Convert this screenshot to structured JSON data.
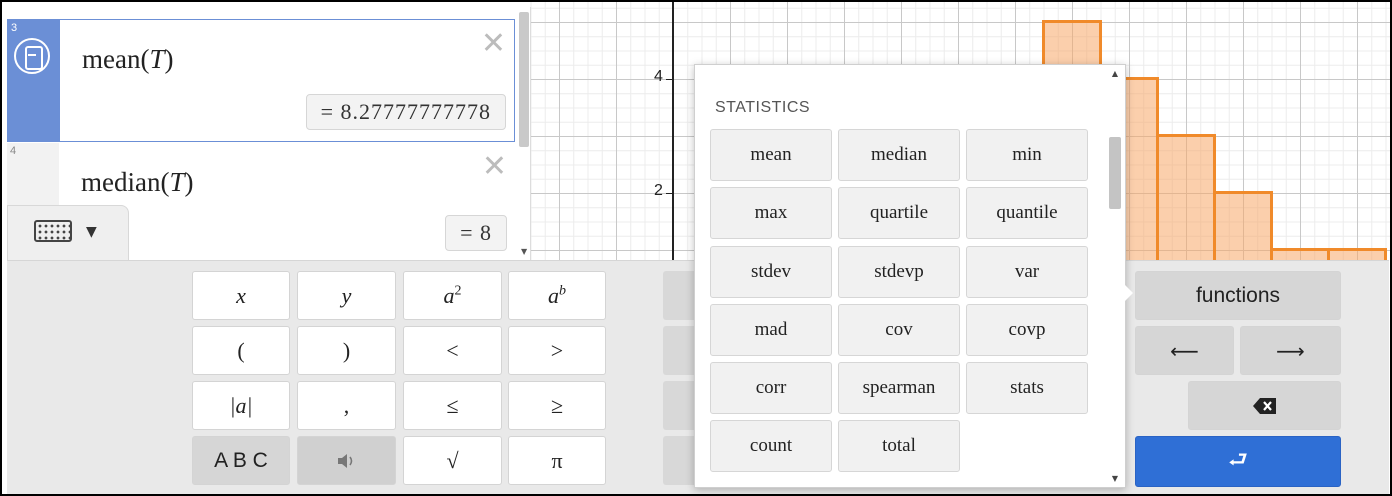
{
  "graph": {
    "y_ticks": [
      "4",
      "2"
    ]
  },
  "expressions": [
    {
      "index": "3",
      "func": "mean",
      "arg": "T",
      "result": "= 8.27777777778"
    },
    {
      "index": "4",
      "func": "median",
      "arg": "T",
      "result": "= 8"
    }
  ],
  "keypad": {
    "x": "x",
    "y": "y",
    "a": "a",
    "sq_exp": "2",
    "b_exp": "b",
    "lparen": "(",
    "rparen": ")",
    "lt": "<",
    "gt": ">",
    "abs": "|a|",
    "comma": ",",
    "le": "≤",
    "ge": "≥",
    "abc": "A B C",
    "sqrt": "√",
    "pi": "π",
    "functions": "functions",
    "left": "⟵",
    "right": "⟶",
    "enter": "⮐"
  },
  "popup": {
    "title": "STATISTICS",
    "functions": [
      "mean",
      "median",
      "min",
      "max",
      "quartile",
      "quantile",
      "stdev",
      "stdevp",
      "var",
      "mad",
      "cov",
      "covp",
      "corr",
      "spearman",
      "stats",
      "count",
      "total"
    ]
  },
  "colors": {
    "accent": "#2f6fd6",
    "selected": "#6b8fd6",
    "histogram_fill": "#f8a868",
    "histogram_stroke": "#f08a2a"
  },
  "icons": [
    "statistics-icon",
    "close-icon",
    "keyboard-icon",
    "chevron-down-icon",
    "speaker-icon",
    "backspace-icon",
    "enter-icon",
    "arrow-left-icon",
    "arrow-right-icon"
  ]
}
